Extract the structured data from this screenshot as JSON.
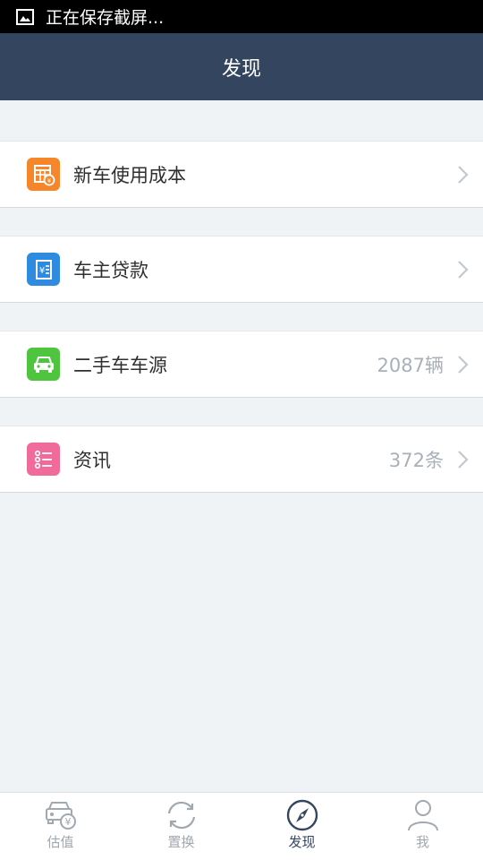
{
  "status_bar": {
    "text": "正在保存截屏..."
  },
  "header": {
    "title": "发现"
  },
  "items": [
    {
      "label": "新车使用成本",
      "count": "",
      "icon": "calculator-icon",
      "color": "#f5862a"
    },
    {
      "label": "车主贷款",
      "count": "",
      "icon": "loan-receipt-icon",
      "color": "#2f8be0"
    },
    {
      "label": "二手车车源",
      "count": "2087辆",
      "icon": "car-icon",
      "color": "#4fc43f"
    },
    {
      "label": "资讯",
      "count": "372条",
      "icon": "news-list-icon",
      "color": "#f06b9a"
    }
  ],
  "tabs": [
    {
      "label": "估值",
      "icon": "car-valuation-icon",
      "active": false
    },
    {
      "label": "置换",
      "icon": "swap-cycle-icon",
      "active": false
    },
    {
      "label": "发现",
      "icon": "compass-icon",
      "active": true
    },
    {
      "label": "我",
      "icon": "person-icon",
      "active": false
    }
  ],
  "colors": {
    "nav": "#34465f",
    "background": "#eff3f6",
    "active_tab": "#34465f",
    "inactive_tab": "#a0a8b0"
  }
}
